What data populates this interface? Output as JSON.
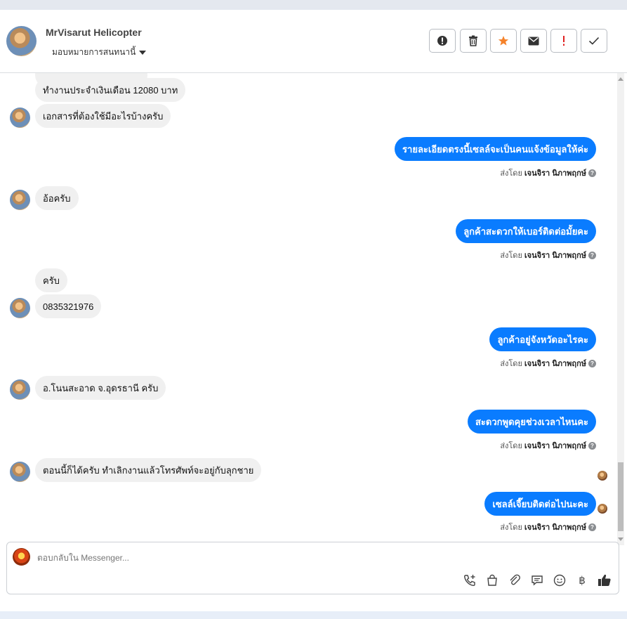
{
  "contact": {
    "name": "MrVisarut Helicopter",
    "assign_label": "มอบหมายการสนทนานี้"
  },
  "toolbar": {
    "icons": [
      "alert-circle-icon",
      "trash-icon",
      "star-icon",
      "envelope-icon",
      "exclamation-icon",
      "check-icon"
    ],
    "star_color": "#f5822a",
    "exclamation_color": "#e02020"
  },
  "messages": [
    {
      "dir": "in",
      "text": "ทำงานประจำเงินเดือน 12080 บาท"
    },
    {
      "dir": "in",
      "text": "เอกสารที่ต้องใช้มีอะไรบ้างครับ"
    },
    {
      "dir": "out",
      "text": "รายละเอียดตรงนี้เซลล์จะเป็นคนแจ้งข้อมูลให้ค่ะ",
      "sent_prefix": "ส่งโดย",
      "sender": "เจนจิรา นิภาพฤกษ์"
    },
    {
      "dir": "in",
      "text": "อ้อครับ"
    },
    {
      "dir": "out",
      "text": "ลูกค้าสะดวกให้เบอร์ติดต่อมั้ยคะ",
      "sent_prefix": "ส่งโดย",
      "sender": "เจนจิรา นิภาพฤกษ์"
    },
    {
      "dir": "in",
      "text": "ครับ"
    },
    {
      "dir": "in",
      "text": "0835321976"
    },
    {
      "dir": "out",
      "text": "ลูกค้าอยู่จังหวัดอะไรคะ",
      "sent_prefix": "ส่งโดย",
      "sender": "เจนจิรา นิภาพฤกษ์"
    },
    {
      "dir": "in",
      "text": "อ.โนนสะอาด จ.อุดรธานี ครับ"
    },
    {
      "dir": "out",
      "text": "สะดวกพูดคุยช่วงเวลาไหนคะ",
      "sent_prefix": "ส่งโดย",
      "sender": "เจนจิรา นิภาพฤกษ์"
    },
    {
      "dir": "in",
      "text": "ตอนนี้ก็ได้ครับ ทำเลิกงานแล้วโทรศัพท์จะอยู่กับลุกชาย"
    },
    {
      "dir": "out",
      "text": "เซลล์เจี๊ยบติดต่อไปนะคะ",
      "sent_prefix": "ส่งโดย",
      "sender": "เจนจิรา นิภาพฤกษ์"
    }
  ],
  "composer": {
    "placeholder": "ตอบกลับใน Messenger...",
    "icons": [
      "phone-plus-icon",
      "shopping-bag-icon",
      "paperclip-icon",
      "chat-bubble-icon",
      "smiley-icon",
      "baht-icon",
      "thumbs-up-icon"
    ],
    "baht_symbol": "฿"
  },
  "colors": {
    "outgoing_bubble": "#0a7cff",
    "incoming_bubble": "#f0f0f0"
  }
}
